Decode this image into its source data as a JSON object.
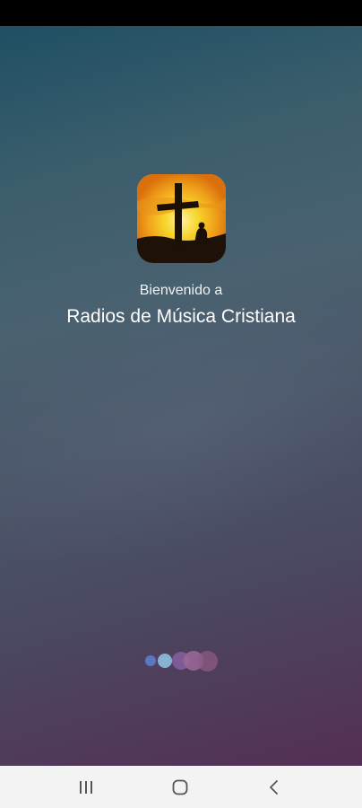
{
  "splash": {
    "welcome": "Bienvenido a",
    "app_name": "Radios de Música Cristiana"
  },
  "logo": {
    "icon": "cross-sunset-icon"
  },
  "loader": {
    "icon": "loading-dots-icon"
  },
  "nav": {
    "recents_icon": "recents-icon",
    "home_icon": "home-icon",
    "back_icon": "back-icon"
  },
  "colors": {
    "gradient_top": "#1f4f63",
    "gradient_bottom": "#542f55",
    "nav_bar": "#f3f3f3"
  }
}
